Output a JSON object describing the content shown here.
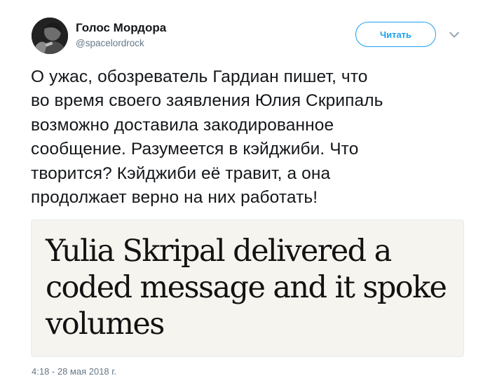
{
  "tweet": {
    "user": {
      "name": "Голос Мордора",
      "handle": "@spacelordrock",
      "avatar_icon": "user-avatar"
    },
    "follow_label": "Читать",
    "menu_icon": "chevron-down-icon",
    "text_lines": [
      "О ужас, обозреватель Гардиан пишет, что",
      "во время своего заявления Юлия Скрипаль",
      "возможно доставила закодированное",
      "сообщение. Разумеется в кэйджиби. Что",
      "творится? Кэйджиби её травит, а она",
      "продолжает верно на них работать!"
    ],
    "card": {
      "headline_lines": [
        "Yulia Skripal delivered a",
        "coded message and it spoke",
        "volumes"
      ],
      "background": "#f6f4ef"
    },
    "timestamp": "4:18 - 28 мая 2018 г."
  },
  "colors": {
    "accent": "#1da1f2",
    "secondary_text": "#657786",
    "primary_text": "#14171a"
  }
}
